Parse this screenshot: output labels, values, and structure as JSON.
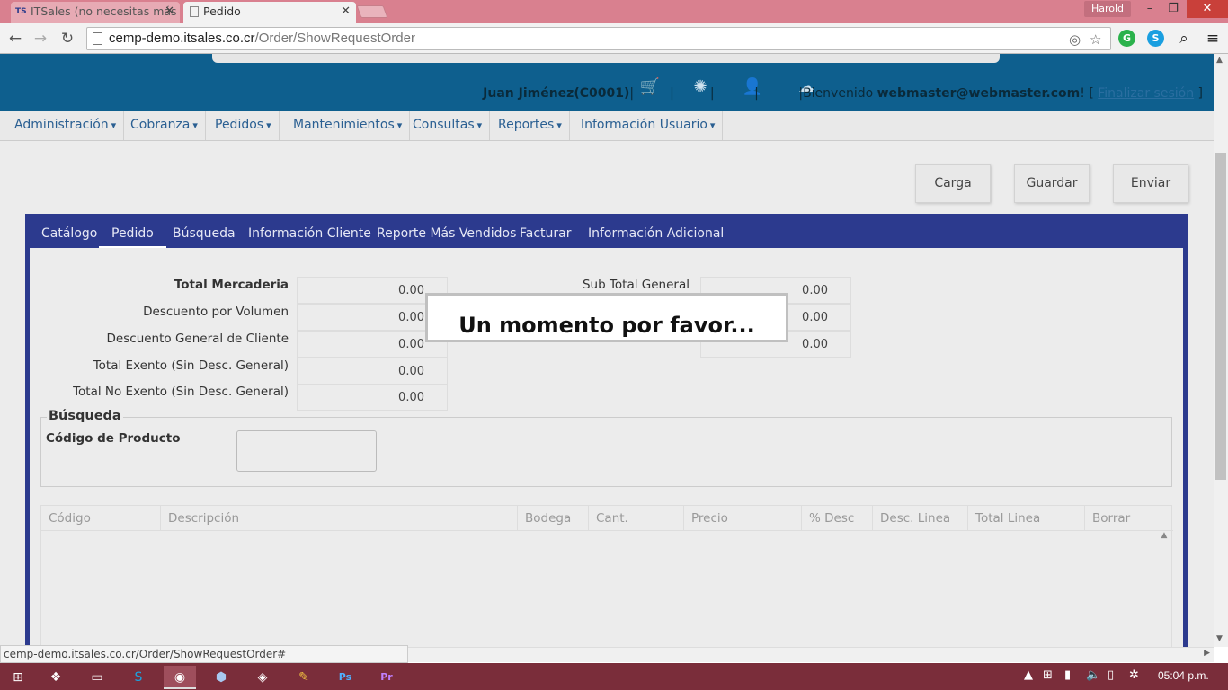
{
  "browser": {
    "tabs": [
      {
        "label": "ITSales (no necesitas más",
        "favicon": "TS"
      },
      {
        "label": "Pedido"
      }
    ],
    "profile": "Harold",
    "url_host": "cemp-demo.itsales.co.cr",
    "url_path": "/Order/ShowRequestOrder",
    "status_url": "cemp-demo.itsales.co.cr/Order/ShowRequestOrder#"
  },
  "header": {
    "customer": "Juan Jiménez(C0001)",
    "welcome": "Bienvenido ",
    "user": "webmaster@webmaster.com",
    "logout": "Finalizar sesión"
  },
  "menu": [
    "Administración",
    "Cobranza",
    "Pedidos",
    "Mantenimientos",
    "Consultas",
    "Reportes",
    "Información Usuario"
  ],
  "actions": {
    "load": "Carga",
    "save": "Guardar",
    "send": "Enviar"
  },
  "order_tabs": [
    "Catálogo",
    "Pedido",
    "Búsqueda",
    "Información Cliente",
    "Reporte Más Vendidos",
    "Facturar",
    "Información Adicional"
  ],
  "totals_left": [
    {
      "label": "Total Mercaderia",
      "value": "0.00"
    },
    {
      "label": "Descuento por Volumen",
      "value": "0.00"
    },
    {
      "label": "Descuento General de Cliente",
      "value": "0.00"
    },
    {
      "label": "Total Exento (Sin Desc. General)",
      "value": "0.00"
    },
    {
      "label": "Total No Exento (Sin Desc. General)",
      "value": "0.00"
    }
  ],
  "totals_right": [
    {
      "label": "Sub Total General",
      "value": "0.00"
    },
    {
      "label": "",
      "value": "0.00"
    },
    {
      "label": "",
      "value": "0.00"
    }
  ],
  "search": {
    "legend": "Búsqueda",
    "product_code_label": "Código de Producto"
  },
  "grid_columns": [
    "Código",
    "Descripción",
    "Bodega",
    "Cant.",
    "Precio",
    "% Desc",
    "Desc. Linea",
    "Total Linea",
    "Borrar"
  ],
  "loading": "Un momento por favor...",
  "taskbar": {
    "clock": "05:04 p.m."
  }
}
